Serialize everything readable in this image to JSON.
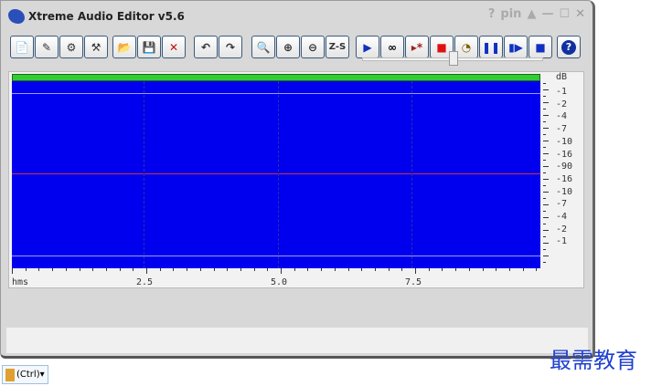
{
  "window": {
    "title": "Xtreme Audio Editor v5.6",
    "controls": [
      "?",
      "pin",
      "▲",
      "—",
      "☐",
      "✕"
    ]
  },
  "toolbar": {
    "file": [
      {
        "icon": "new-icon",
        "label": "📄"
      },
      {
        "icon": "properties-icon",
        "label": "✎"
      },
      {
        "icon": "settings-icon",
        "label": "⚙"
      },
      {
        "icon": "tools-icon",
        "label": "⚒"
      }
    ],
    "edit": [
      {
        "icon": "open-folder-icon",
        "label": "📂"
      },
      {
        "icon": "save-icon",
        "label": "💾"
      },
      {
        "icon": "delete-icon",
        "label": "✕"
      }
    ],
    "history": [
      {
        "icon": "undo-icon",
        "label": "↶"
      },
      {
        "icon": "redo-icon",
        "label": "↷"
      }
    ],
    "zoom": [
      {
        "icon": "zoom-icon",
        "label": "🔍"
      },
      {
        "icon": "zoom-in-icon",
        "label": "⊕"
      },
      {
        "icon": "zoom-out-icon",
        "label": "⊖"
      },
      {
        "icon": "zoom-selection-icon",
        "label": "Z-S"
      }
    ],
    "transport": [
      {
        "icon": "play-icon",
        "label": "▶"
      },
      {
        "icon": "loop-icon",
        "label": "∞"
      },
      {
        "icon": "play-from-icon",
        "label": "▸*"
      },
      {
        "icon": "stop-icon",
        "label": "■"
      },
      {
        "icon": "timer-icon",
        "label": "◔"
      },
      {
        "icon": "pause-icon",
        "label": "❚❚"
      },
      {
        "icon": "fast-forward-icon",
        "label": "▮▶"
      },
      {
        "icon": "record-stop-icon",
        "label": "■"
      }
    ],
    "help": {
      "icon": "help-icon",
      "label": "?"
    }
  },
  "position_slider": {
    "value_percent": 50
  },
  "waveform": {
    "db_label": "dB",
    "db_ticks": [
      "-1",
      "-2",
      "-4",
      "-7",
      "-10",
      "-16",
      "-90",
      "-16",
      "-10",
      "-7",
      "-4",
      "-2",
      "-1"
    ],
    "time_unit": "hms",
    "time_ticks": [
      "2.5",
      "5.0",
      "7.5"
    ],
    "colors": {
      "background": "#0000ee",
      "level": "#33cc33",
      "center": "#cc3333"
    }
  },
  "clipboard": {
    "label": "(Ctrl)▾"
  },
  "watermark": "最需教育"
}
